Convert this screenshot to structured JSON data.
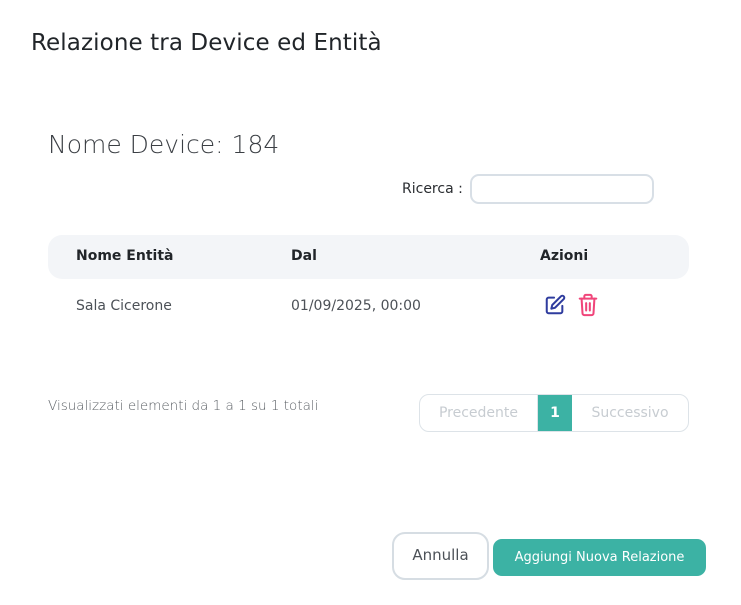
{
  "modal": {
    "title": "Relazione tra Device ed Entità"
  },
  "device": {
    "title": "Nome Device: 184"
  },
  "search": {
    "label": "Ricerca :",
    "value": ""
  },
  "table": {
    "headers": [
      "Nome Entità",
      "Dal",
      "Azioni"
    ],
    "rows": [
      {
        "entity": "Sala Cicerone",
        "from": "01/09/2025, 00:00",
        "actions": [
          "edit-icon",
          "trash-icon"
        ]
      }
    ]
  },
  "pagination": {
    "info": "Visualizzati elementi da 1 a 1 su 1 totali",
    "prev_label": "Precedente",
    "current_page": "1",
    "next_label": "Successivo"
  },
  "footer": {
    "cancel_label": "Annulla",
    "add_label": "Aggiungi Nuova Relazione"
  },
  "colors": {
    "accent": "#3cb2a4",
    "edit_icon": "#2f3c9e",
    "delete_icon": "#f0457a"
  }
}
